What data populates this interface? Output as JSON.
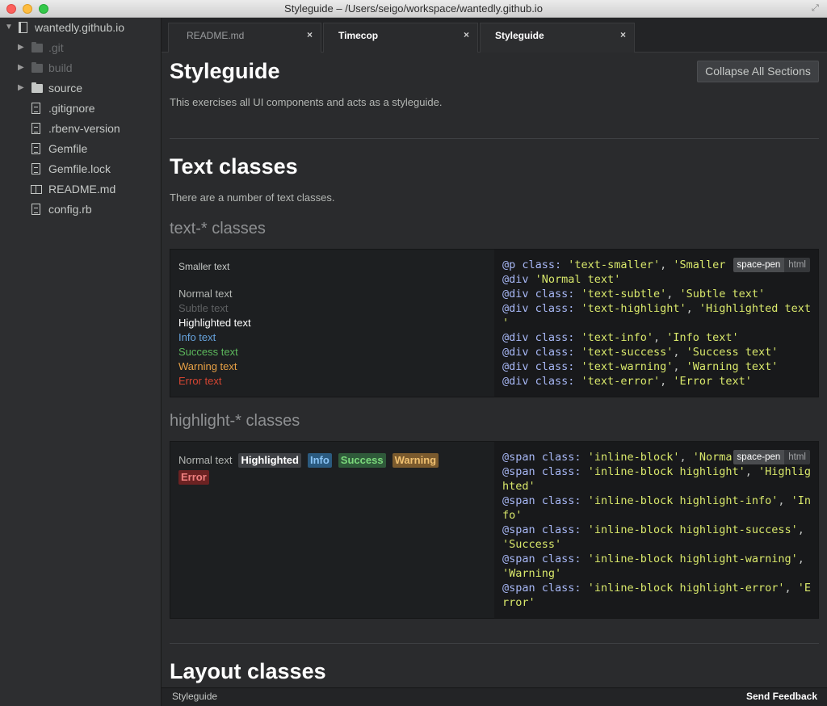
{
  "window": {
    "title": "Styleguide – /Users/seigo/workspace/wantedly.github.io"
  },
  "tree": {
    "root": "wantedly.github.io",
    "items": [
      {
        "label": ".git",
        "kind": "folder",
        "dim": true
      },
      {
        "label": "build",
        "kind": "folder",
        "dim": true
      },
      {
        "label": "source",
        "kind": "folder",
        "dim": false
      },
      {
        "label": ".gitignore",
        "kind": "file"
      },
      {
        "label": ".rbenv-version",
        "kind": "file"
      },
      {
        "label": "Gemfile",
        "kind": "file"
      },
      {
        "label": "Gemfile.lock",
        "kind": "file"
      },
      {
        "label": "README.md",
        "kind": "book"
      },
      {
        "label": "config.rb",
        "kind": "file"
      }
    ]
  },
  "tabs": [
    {
      "label": "README.md",
      "close": "×"
    },
    {
      "label": "Timecop",
      "close": "×"
    },
    {
      "label": "Styleguide",
      "close": "×"
    }
  ],
  "page": {
    "title": "Styleguide",
    "description": "This exercises all UI components and acts as a styleguide.",
    "collapse_label": "Collapse All Sections"
  },
  "text_section": {
    "title": "Text classes",
    "description": "There are a number of text classes.",
    "subtitle": "text-* classes",
    "samples": {
      "smaller": "Smaller text",
      "normal": "Normal text",
      "subtle": "Subtle text",
      "highlight": "Highlighted text",
      "info": "Info text",
      "success": "Success text",
      "warning": "Warning text",
      "error": "Error text"
    },
    "code_tags": {
      "spacepen": "space-pen",
      "html": "html"
    }
  },
  "highlight_section": {
    "subtitle": "highlight-* classes",
    "samples": {
      "normal": "Normal text",
      "highlighted": "Highlighted",
      "info": "Info",
      "success": "Success",
      "warning": "Warning",
      "error": "Error"
    },
    "code_tags": {
      "spacepen": "space-pen",
      "html": "html"
    }
  },
  "layout_section": {
    "title": "Layout classes"
  },
  "status": {
    "left": "Styleguide",
    "right": "Send Feedback"
  }
}
